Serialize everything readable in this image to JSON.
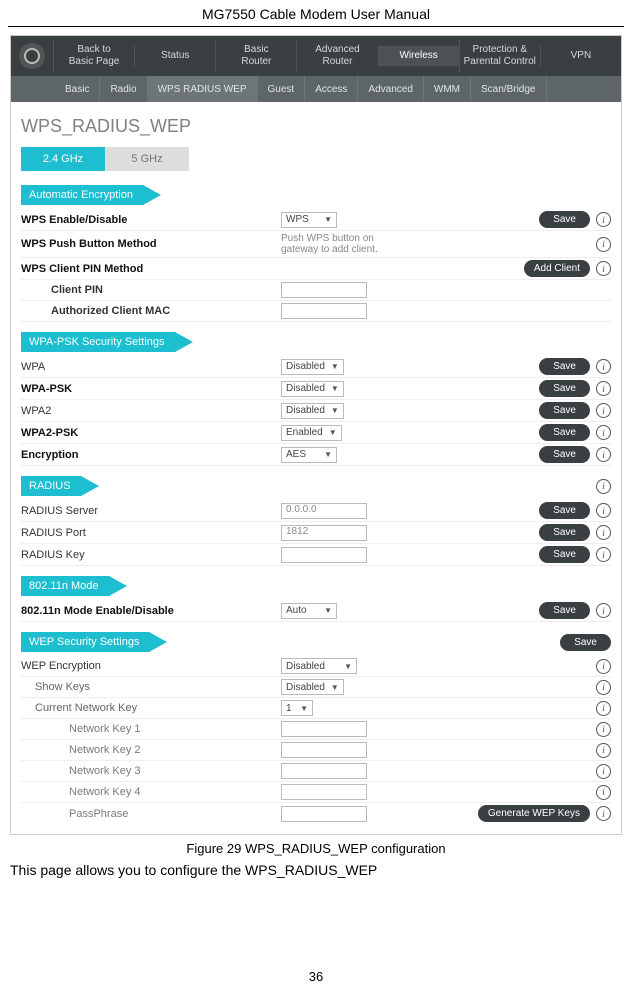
{
  "doc": {
    "title": "MG7550 Cable Modem User Manual",
    "figure_caption": "Figure 29 WPS_RADIUS_WEP configuration",
    "body_text": "This page allows you to configure the WPS_RADIUS_WEP",
    "page_number": "36"
  },
  "topnav": {
    "items": [
      {
        "label": "Back to\nBasic Page",
        "name": "nav-back-to-basic"
      },
      {
        "label": "Status",
        "name": "nav-status"
      },
      {
        "label": "Basic\nRouter",
        "name": "nav-basic-router"
      },
      {
        "label": "Advanced\nRouter",
        "name": "nav-advanced-router"
      },
      {
        "label": "Wireless",
        "name": "nav-wireless",
        "active": true
      },
      {
        "label": "Protection &\nParental Control",
        "name": "nav-protection"
      },
      {
        "label": "VPN",
        "name": "nav-vpn"
      }
    ]
  },
  "subnav": {
    "items": [
      {
        "label": "Basic",
        "name": "subnav-basic"
      },
      {
        "label": "Radio",
        "name": "subnav-radio"
      },
      {
        "label": "WPS RADIUS WEP",
        "name": "subnav-wps-radius-wep",
        "active": true
      },
      {
        "label": "Guest",
        "name": "subnav-guest"
      },
      {
        "label": "Access",
        "name": "subnav-access"
      },
      {
        "label": "Advanced",
        "name": "subnav-advanced"
      },
      {
        "label": "WMM",
        "name": "subnav-wmm"
      },
      {
        "label": "Scan/Bridge",
        "name": "subnav-scan-bridge"
      }
    ]
  },
  "page_heading": "WPS_RADIUS_WEP",
  "band_tabs": {
    "active": "2.4 GHz",
    "inactive": "5 GHz"
  },
  "buttons": {
    "save": "Save",
    "add_client": "Add Client",
    "gen_wep": "Generate WEP Keys"
  },
  "info_glyph": "i",
  "sections": {
    "auto_enc": {
      "title": "Automatic Encryption",
      "rows": {
        "wps_enable": {
          "label": "WPS Enable/Disable",
          "select": "WPS"
        },
        "push_btn": {
          "label": "WPS Push Button Method",
          "hint": "Push WPS button on gateway to add client."
        },
        "client_pin": {
          "label": "WPS Client PIN Method"
        },
        "pin": {
          "label": "Client PIN"
        },
        "auth_mac": {
          "label": "Authorized Client MAC"
        }
      }
    },
    "wpa_psk": {
      "title": "WPA-PSK Security Settings",
      "rows": {
        "wpa": {
          "label": "WPA",
          "select": "Disabled"
        },
        "wpapsk": {
          "label": "WPA-PSK",
          "select": "Disabled"
        },
        "wpa2": {
          "label": "WPA2",
          "select": "Disabled"
        },
        "wpa2psk": {
          "label": "WPA2-PSK",
          "select": "Enabled"
        },
        "encryption": {
          "label": "Encryption",
          "select": "AES"
        }
      }
    },
    "radius": {
      "title": "RADIUS",
      "rows": {
        "server": {
          "label": "RADIUS Server",
          "value": "0.0.0.0"
        },
        "port": {
          "label": "RADIUS Port",
          "value": "1812"
        },
        "key": {
          "label": "RADIUS Key",
          "value": ""
        }
      }
    },
    "n_mode": {
      "title": "802.11n Mode",
      "rows": {
        "enable": {
          "label": "802.11n Mode Enable/Disable",
          "select": "Auto"
        }
      }
    },
    "wep": {
      "title": "WEP Security Settings",
      "rows": {
        "wep_enc": {
          "label": "WEP Encryption",
          "select": "Disabled"
        },
        "show_keys": {
          "label": "Show Keys",
          "select": "Disabled"
        },
        "cur_key": {
          "label": "Current Network Key",
          "select": "1"
        },
        "k1": {
          "label": "Network Key 1"
        },
        "k2": {
          "label": "Network Key 2"
        },
        "k3": {
          "label": "Network Key 3"
        },
        "k4": {
          "label": "Network Key 4"
        },
        "pass": {
          "label": "PassPhrase"
        }
      }
    }
  }
}
